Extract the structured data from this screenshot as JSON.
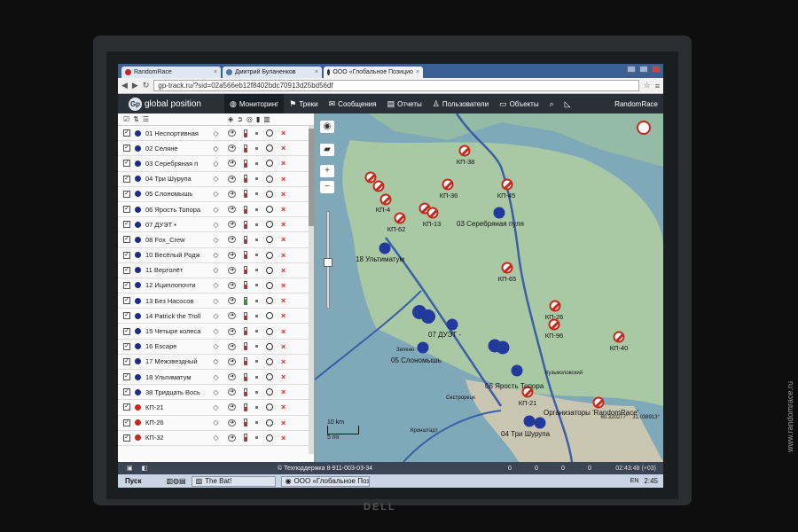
{
  "browser": {
    "tabs": [
      {
        "label": "RandomRace",
        "active": false
      },
      {
        "label": "Дмитрий Буланенков",
        "active": false
      },
      {
        "label": "ООО «Глобальное Позицио",
        "active": true
      }
    ],
    "url": "gp-track.ru/?sid=02a566eb12f8402bdc70913d25bd56df"
  },
  "app": {
    "logo_text": "global position",
    "nav": [
      {
        "label": "Мониторинг",
        "icon": "globe-icon",
        "active": true
      },
      {
        "label": "Треки",
        "icon": "flag-icon",
        "active": false
      },
      {
        "label": "Сообщения",
        "icon": "message-icon",
        "active": false
      },
      {
        "label": "Отчеты",
        "icon": "report-icon",
        "active": false
      },
      {
        "label": "Пользователи",
        "icon": "users-icon",
        "active": false
      },
      {
        "label": "Объекты",
        "icon": "car-icon",
        "active": false
      }
    ],
    "user": "RandomRace"
  },
  "units": [
    {
      "name": "01 Неспортивная",
      "kind": "team"
    },
    {
      "name": "02 Селяне",
      "kind": "team"
    },
    {
      "name": "03 Серебряная п",
      "kind": "team"
    },
    {
      "name": "04 Три Шурупа",
      "kind": "team"
    },
    {
      "name": "05 Слономышь",
      "kind": "team"
    },
    {
      "name": "06 Ярость Топора",
      "kind": "team"
    },
    {
      "name": "07 ДУЭТ •",
      "kind": "team"
    },
    {
      "name": "08 Fox_Crew",
      "kind": "team"
    },
    {
      "name": "10 Весёлый Родж",
      "kind": "team"
    },
    {
      "name": "11 Вертолёт",
      "kind": "team"
    },
    {
      "name": "12 Ициплопочти",
      "kind": "team"
    },
    {
      "name": "13 Без Насосов",
      "kind": "team"
    },
    {
      "name": "14 Patrick the Troll",
      "kind": "team"
    },
    {
      "name": "15 Четыре колеса",
      "kind": "team"
    },
    {
      "name": "16 Escape",
      "kind": "team"
    },
    {
      "name": "17 Межзвездный",
      "kind": "team"
    },
    {
      "name": "18 Ультиматум",
      "kind": "team"
    },
    {
      "name": "38 Тридцать Вось",
      "kind": "team"
    },
    {
      "name": "КП-21",
      "kind": "cp"
    },
    {
      "name": "КП-26",
      "kind": "cp"
    },
    {
      "name": "КП-32",
      "kind": "cp"
    }
  ],
  "map": {
    "checkpoints": [
      "КП-38",
      "КП-36",
      "КП-45",
      "КП-4",
      "КП-62",
      "КП-13",
      "КП-65",
      "КП-26",
      "КП-96",
      "КП-40",
      "КП-21"
    ],
    "teams": [
      "03 Серебряная пуля",
      "18 Ультиматум",
      "07 ДУЭТ -",
      "05 Слономышь",
      "06 Ярость Топора",
      "04 Три Шурупа",
      "Организаторы 'RandomRace'"
    ],
    "places": [
      "Сестрорецк",
      "Кронштадт",
      "Зелено",
      "Кузьмоловский"
    ],
    "scale": [
      "10 km",
      "5 mi"
    ],
    "coords": "60.320277° : 31.038913°"
  },
  "footer": {
    "support": "© Техподдержка 8-911-003-03-34",
    "time": "02:43:48 (+03)",
    "counts": [
      "0",
      "0",
      "0",
      "0"
    ]
  },
  "taskbar": {
    "start": "Пуск",
    "tasks": [
      "The Bat!",
      "ООО «Глобальное Поз..."
    ],
    "lang": "EN",
    "clock": "2:45"
  },
  "hardware": {
    "brand": "DELL"
  },
  "watermark": "www.randomrace.ru"
}
